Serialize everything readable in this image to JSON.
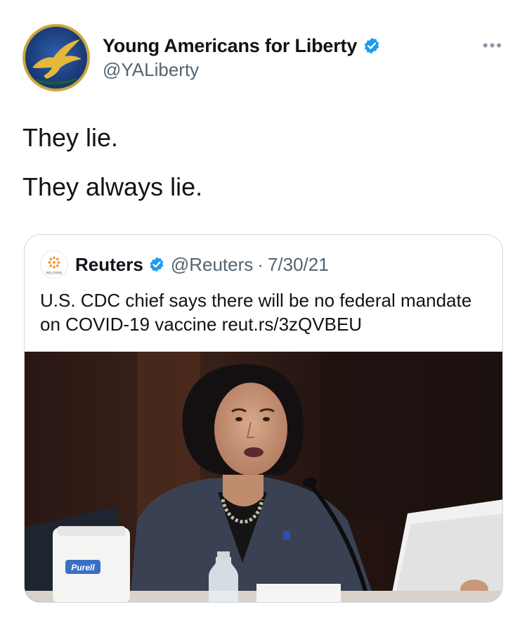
{
  "tweet": {
    "author": {
      "display_name": "Young Americans for Liberty",
      "handle": "@YALiberty",
      "verified": true,
      "avatar_icon": "eagle-logo-icon"
    },
    "more_label": "•••",
    "text_lines": [
      "They lie.",
      "They always lie."
    ]
  },
  "quoted_tweet": {
    "author": {
      "display_name": "Reuters",
      "handle": "@Reuters",
      "verified": true,
      "avatar_icon": "reuters-logo-icon",
      "avatar_text": "REUTERS"
    },
    "separator": "·",
    "date": "7/30/21",
    "text": "U.S. CDC chief says there will be no federal mandate on COVID-19 vaccine reut.rs/3zQVBEU",
    "media": {
      "type": "photo",
      "bottle_label": "Purell"
    }
  },
  "colors": {
    "verified_blue": "#1d9bf0",
    "secondary_text": "#536471",
    "border": "#cfd9de"
  }
}
